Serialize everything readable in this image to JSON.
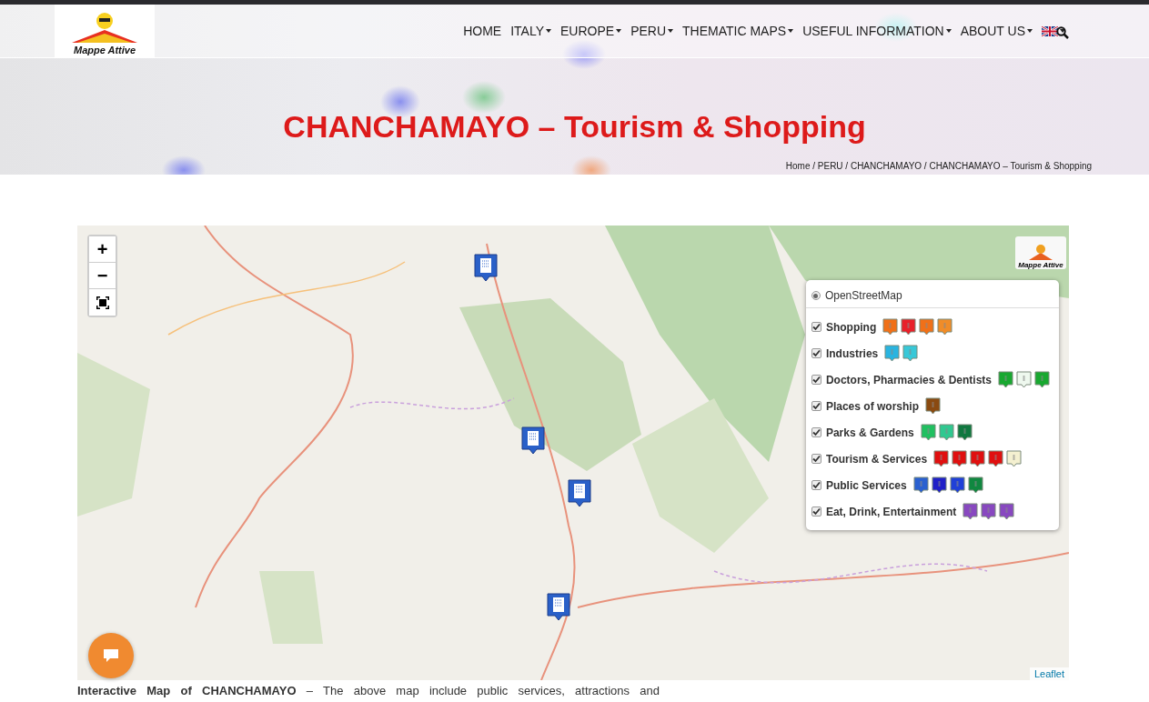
{
  "header": {
    "logo_text": "Mappe Attive",
    "nav": [
      {
        "label": "HOME",
        "dropdown": false
      },
      {
        "label": "ITALY",
        "dropdown": true
      },
      {
        "label": "EUROPE",
        "dropdown": true
      },
      {
        "label": "PERU",
        "dropdown": true
      },
      {
        "label": "THEMATIC MAPS",
        "dropdown": true
      },
      {
        "label": "USEFUL INFORMATION",
        "dropdown": true
      },
      {
        "label": "ABOUT US",
        "dropdown": true
      }
    ]
  },
  "hero": {
    "title": "CHANCHAMAYO – Tourism & Shopping",
    "breadcrumb": "Home / PERU / CHANCHAMAYO / CHANCHAMAYO – Tourism & Shopping"
  },
  "map": {
    "zoom_in": "+",
    "zoom_out": "−",
    "attribution": "Leaflet",
    "logo_text": "Mappe Attive",
    "base_layers": [
      {
        "label": "OpenStreetMap",
        "selected": true
      }
    ],
    "overlays": [
      {
        "label": "Shopping",
        "checked": true,
        "icons": [
          {
            "color": "#f07018"
          },
          {
            "color": "#e8202a"
          },
          {
            "color": "#f07018"
          },
          {
            "color": "#f08c28"
          }
        ]
      },
      {
        "label": "Industries",
        "checked": true,
        "icons": [
          {
            "color": "#2ab4e0"
          },
          {
            "color": "#38c8d8"
          }
        ]
      },
      {
        "label": "Doctors, Pharmacies & Dentists",
        "checked": true,
        "icons": [
          {
            "color": "#18a830"
          },
          {
            "color": "#eef8ee"
          },
          {
            "color": "#18a830"
          }
        ]
      },
      {
        "label": "Places of worship",
        "checked": true,
        "icons": [
          {
            "color": "#8a4a10"
          }
        ]
      },
      {
        "label": "Parks & Gardens",
        "checked": true,
        "icons": [
          {
            "color": "#20c060"
          },
          {
            "color": "#30c890"
          },
          {
            "color": "#107840"
          }
        ]
      },
      {
        "label": "Tourism & Services",
        "checked": true,
        "icons": [
          {
            "color": "#e01010"
          },
          {
            "color": "#e01010"
          },
          {
            "color": "#e01010"
          },
          {
            "color": "#e01010"
          },
          {
            "color": "#f4f0d0"
          }
        ]
      },
      {
        "label": "Public Services",
        "checked": true,
        "icons": [
          {
            "color": "#2a60d0"
          },
          {
            "color": "#2020c8"
          },
          {
            "color": "#2040d8"
          },
          {
            "color": "#108840"
          }
        ]
      },
      {
        "label": "Eat, Drink, Entertainment",
        "checked": true,
        "icons": [
          {
            "color": "#8848c0"
          },
          {
            "color": "#8848c0"
          },
          {
            "color": "#8848c0"
          }
        ]
      }
    ]
  },
  "intro": "**Interactive Map of CHANCHAMAYO** – The above map include public services, attractions and"
}
